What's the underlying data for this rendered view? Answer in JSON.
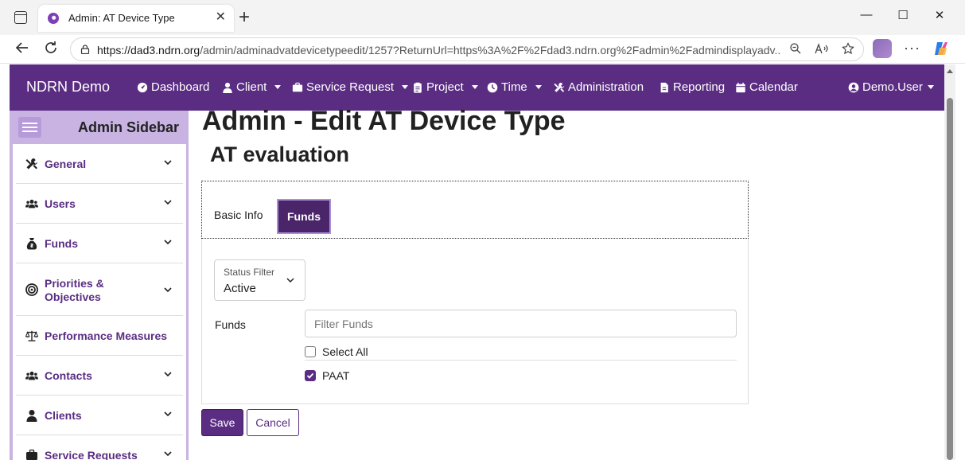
{
  "browser": {
    "tab_title": "Admin: AT Device Type",
    "url_host": "https://dad3.ndrn.org",
    "url_path": "/admin/adminadvatdevicetypeedit/1257?ReturnUrl=https%3A%2F%2Fdad3.ndrn.org%2Fadmin%2Fadmindisplayadv...",
    "minimize_glyph": "—",
    "maximize_glyph": "☐",
    "close_glyph": "✕",
    "newtab_glyph": "+",
    "tab_close_glyph": "✕"
  },
  "navbar": {
    "brand": "NDRN Demo",
    "items": [
      {
        "label": "Dashboard",
        "icon": "dashboard-icon",
        "caret": false
      },
      {
        "label": "Client",
        "icon": "user-icon",
        "caret": true
      },
      {
        "label": "Service Request",
        "icon": "briefcase-icon",
        "caret": true
      },
      {
        "label": "Project",
        "icon": "clipboard-icon",
        "caret": true
      },
      {
        "label": "Time",
        "icon": "clock-icon",
        "caret": true
      },
      {
        "label": "Administration",
        "icon": "tools-icon",
        "caret": false
      },
      {
        "label": "Reporting",
        "icon": "file-icon",
        "caret": false
      },
      {
        "label": "Calendar",
        "icon": "calendar-icon",
        "caret": false
      }
    ],
    "user": "Demo.User"
  },
  "sidebar": {
    "title": "Admin Sidebar",
    "items": [
      {
        "label": "General",
        "icon": "tools-icon"
      },
      {
        "label": "Users",
        "icon": "users-icon"
      },
      {
        "label": "Funds",
        "icon": "money-bag-icon"
      },
      {
        "label": "Priorities & Objectives",
        "icon": "target-icon"
      },
      {
        "label": "Performance Measures",
        "icon": "scale-icon"
      },
      {
        "label": "Contacts",
        "icon": "users-icon"
      },
      {
        "label": "Clients",
        "icon": "user-icon"
      },
      {
        "label": "Service Requests",
        "icon": "briefcase-icon"
      }
    ]
  },
  "page": {
    "title": "Admin - Edit AT Device Type",
    "subtitle": "AT evaluation",
    "tabs": [
      "Basic Info",
      "Funds"
    ],
    "active_tab": "Funds",
    "status_filter": {
      "label": "Status Filter",
      "value": "Active"
    },
    "funds_label": "Funds",
    "filter_placeholder": "Filter Funds",
    "select_all": {
      "label": "Select All",
      "checked": false
    },
    "funds": [
      {
        "label": "PAAT",
        "checked": true
      }
    ],
    "save": "Save",
    "cancel": "Cancel"
  },
  "colors": {
    "brand": "#5a2d82",
    "sidebar_bg": "#c8b3e3",
    "active_tab": "#4a2569"
  }
}
